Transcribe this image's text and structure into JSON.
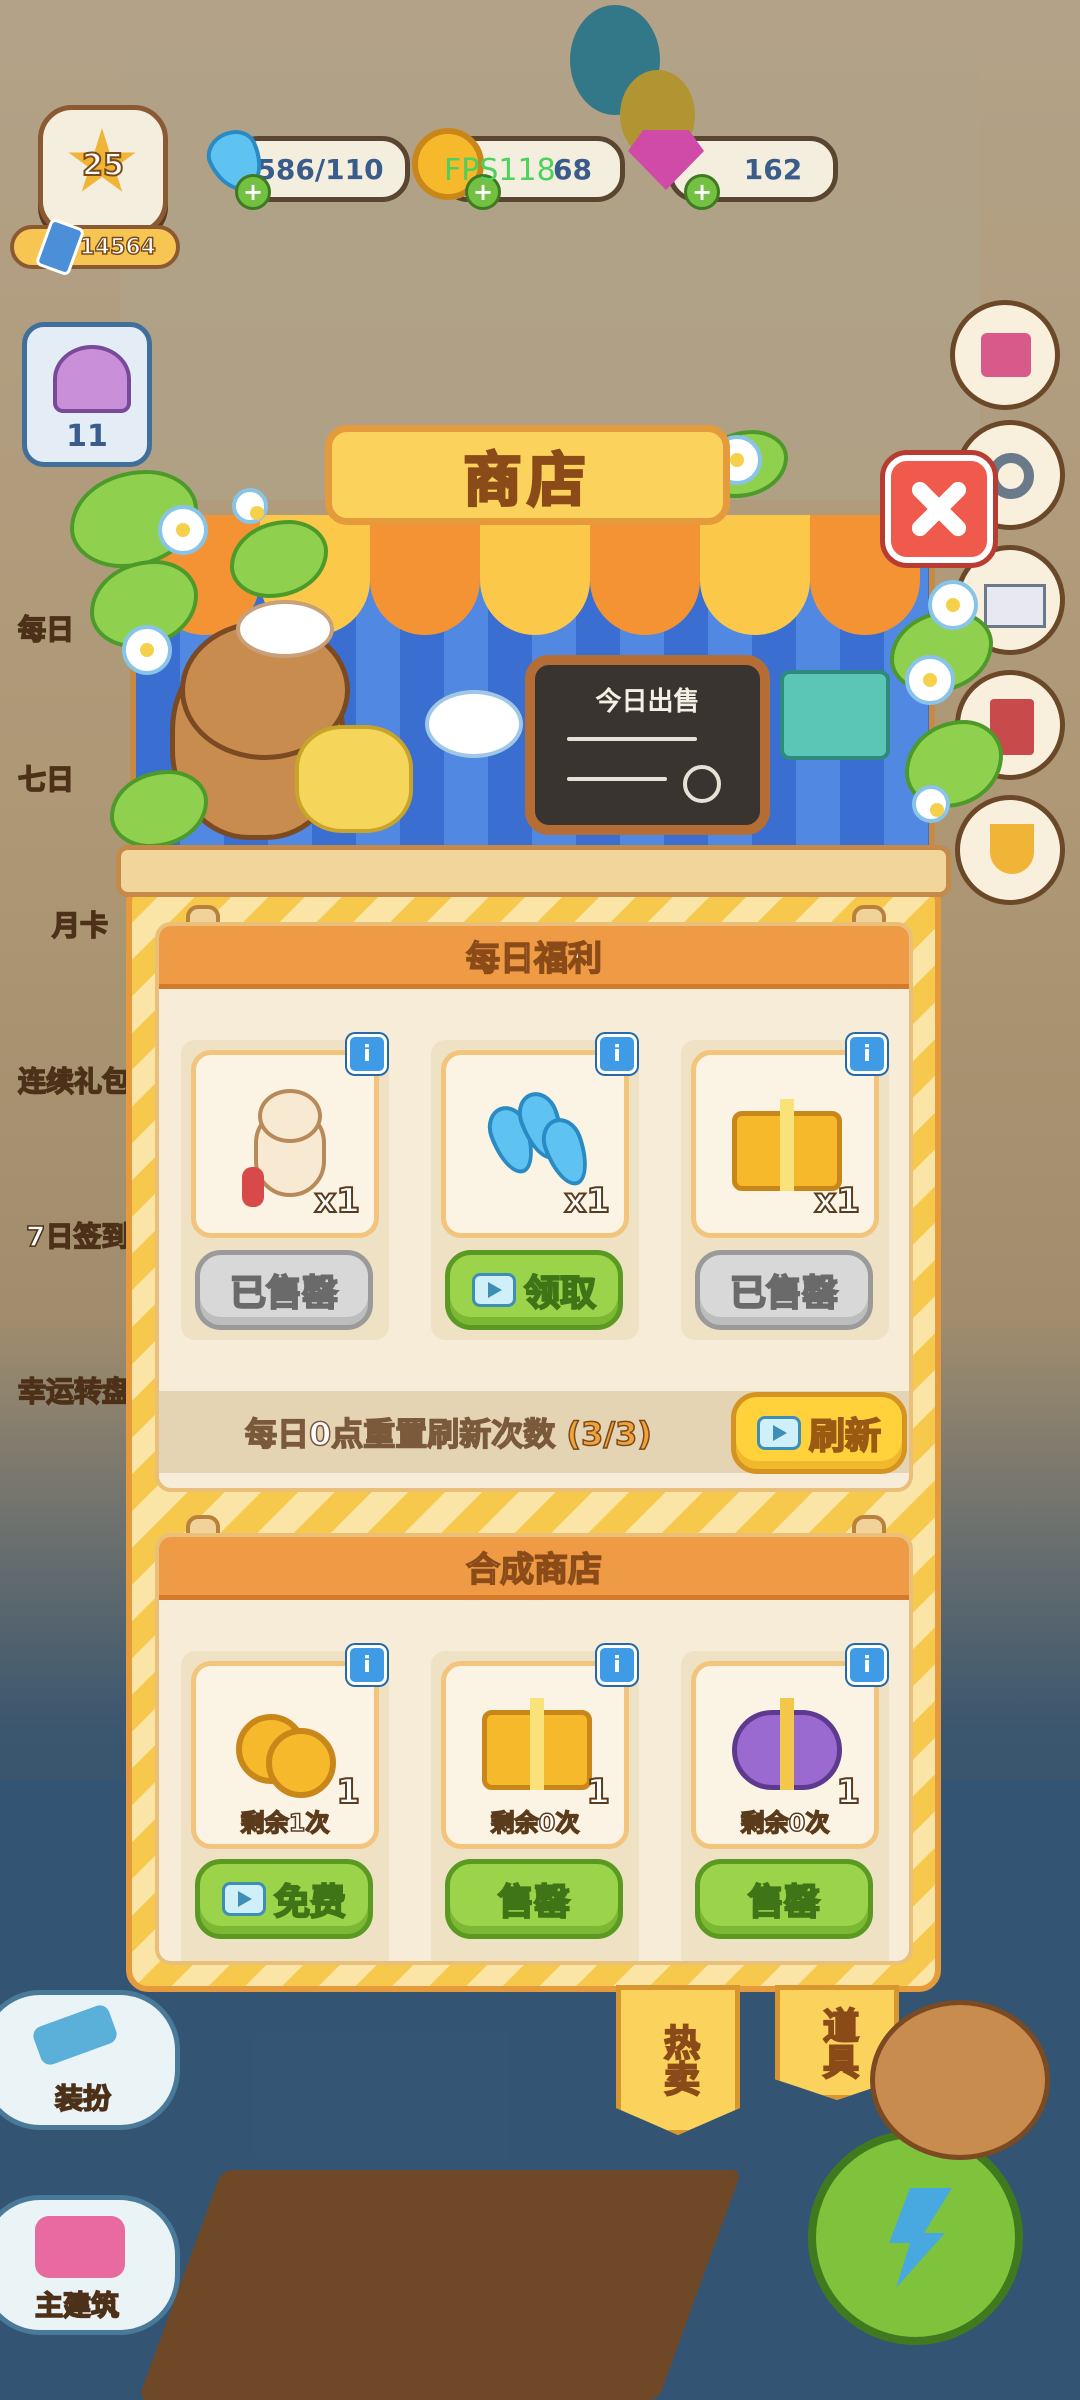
{
  "hud": {
    "level": "25",
    "coins": "14564",
    "energy": "586/110",
    "gold_partial": "68",
    "gems": "162",
    "fps": "FPS118",
    "shell_count": "11"
  },
  "left_menu": [
    "每日",
    "七日",
    "月卡",
    "连续礼包",
    "7日签到",
    "幸运转盘"
  ],
  "bottom_left": {
    "decorate": "装扮",
    "main_building": "主建筑"
  },
  "shop": {
    "title": "商店",
    "board_title": "今日出售",
    "daily": {
      "header": "每日福利",
      "items": [
        {
          "name": "cat-pet",
          "qty": "x1",
          "button": "已售罄",
          "state": "sold"
        },
        {
          "name": "energy-drops",
          "qty": "x1",
          "button": "领取",
          "state": "claim"
        },
        {
          "name": "gold-gift-box",
          "qty": "x1",
          "button": "已售罄",
          "state": "sold"
        }
      ],
      "refresh_text": "每日0点重置刷新次数",
      "refresh_count": "(3/3)",
      "refresh_button": "刷新"
    },
    "merge": {
      "header": "合成商店",
      "items": [
        {
          "name": "coins",
          "qty": "1",
          "remain": "剩余1次",
          "button": "免费",
          "video": true
        },
        {
          "name": "gold-gift-box",
          "qty": "1",
          "remain": "剩余0次",
          "button": "售罄",
          "video": false
        },
        {
          "name": "purple-gift-box",
          "qty": "1",
          "remain": "剩余0次",
          "button": "售罄",
          "video": false
        }
      ]
    },
    "tabs": [
      {
        "label": "热卖",
        "selected": true
      },
      {
        "label": "道具",
        "selected": false
      }
    ]
  },
  "colors": {
    "panel_border": "#e59a3c",
    "header_orange": "#ef9a44",
    "button_green": "#9bd44a",
    "button_gray": "#d8d8d8",
    "close_red": "#ef5a4c"
  }
}
